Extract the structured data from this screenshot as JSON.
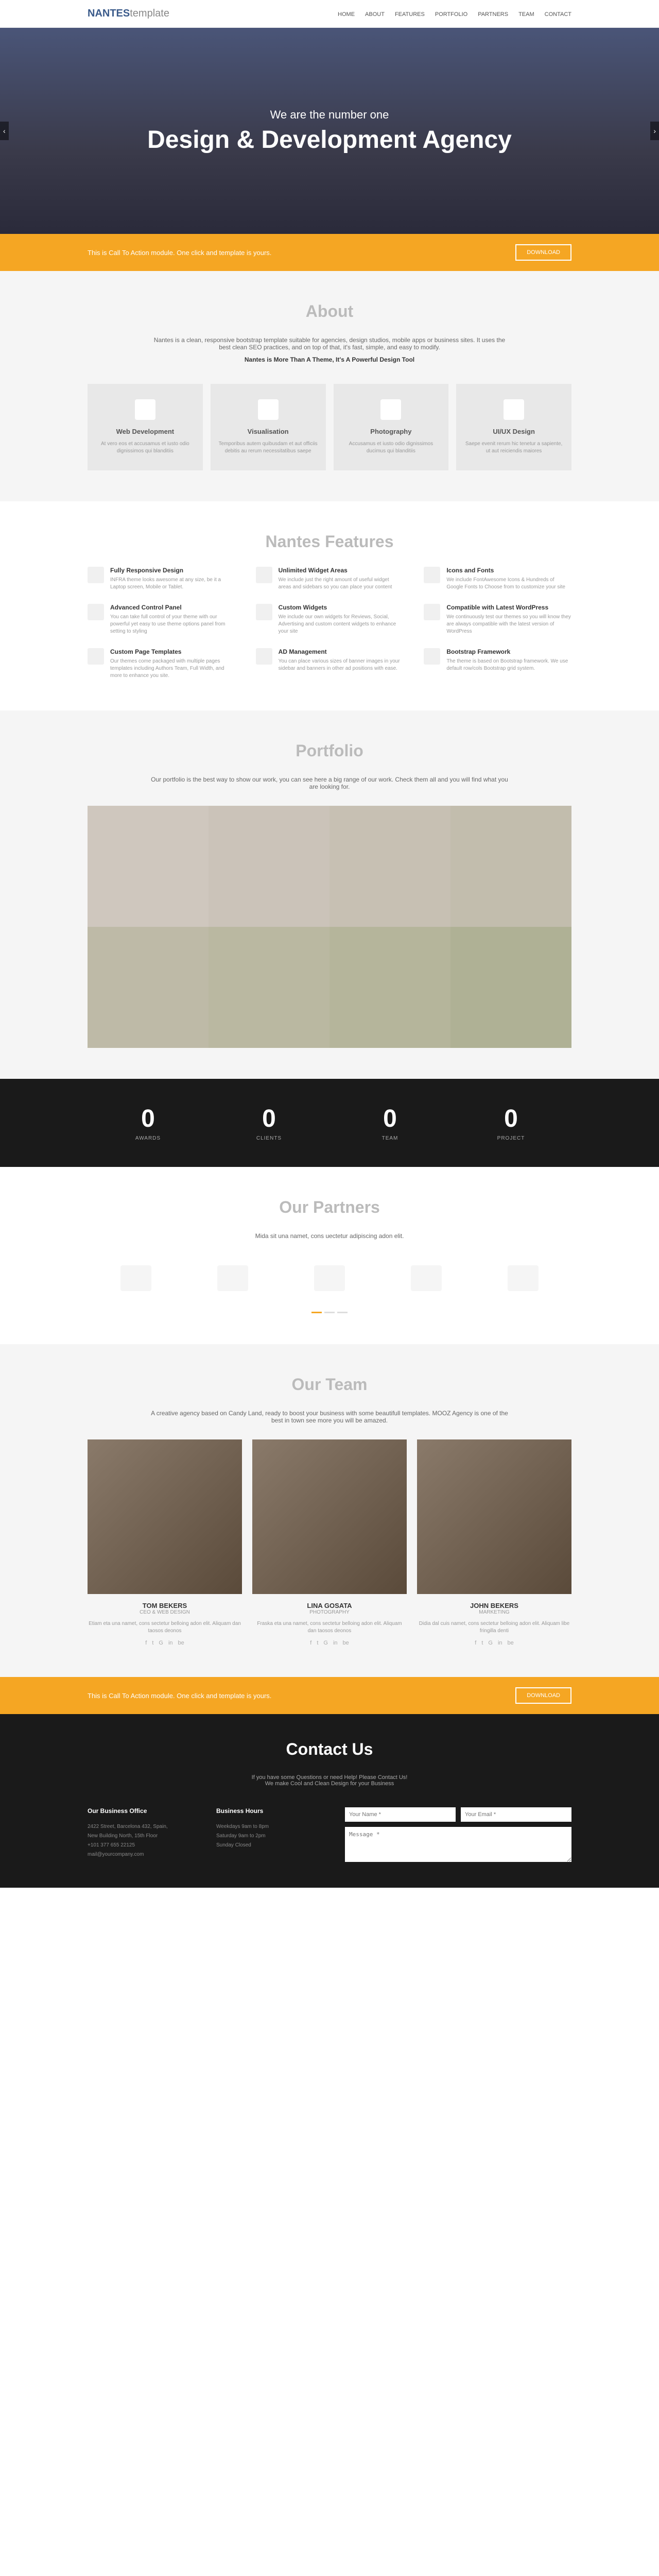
{
  "logo": {
    "bold": "NANTES",
    "light": "template"
  },
  "nav": [
    "HOME",
    "ABOUT",
    "FEATURES",
    "PORTFOLIO",
    "PARTNERS",
    "TEAM",
    "CONTACT"
  ],
  "hero": {
    "sub": "We are the number one",
    "title": "Design & Development Agency"
  },
  "cta": {
    "text": "This is Call To Action module. One click and template is yours.",
    "btn": "DOWNLOAD"
  },
  "about": {
    "title": "About",
    "desc": "Nantes is a clean, responsive bootstrap template suitable for agencies, design studios, mobile apps or business sites. It uses the best clean SEO practices, and on top of that, it's fast, simple, and easy to modify.",
    "tagline": "Nantes is More Than A Theme, It's A Powerful Design Tool",
    "cards": [
      {
        "title": "Web Development",
        "desc": "At vero eos et accusamus et iusto odio dignissimos qui blanditiis"
      },
      {
        "title": "Visualisation",
        "desc": "Temporibus autem quibusdam et aut officiis debitis au rerum necessitatibus saepe"
      },
      {
        "title": "Photography",
        "desc": "Accusamus et iusto odio dignissimos ducimus qui blanditiis"
      },
      {
        "title": "UI/UX Design",
        "desc": "Saepe evenit rerum hic tenetur a sapiente, ut aut reiciendis maiores"
      }
    ]
  },
  "features": {
    "title": "Nantes Features",
    "items": [
      {
        "title": "Fully Responsive Design",
        "desc": "INFRA theme looks awesome at any size, be it a Laptop screen, Mobile or Tablet."
      },
      {
        "title": "Unlimited Widget Areas",
        "desc": "We include just the right amount of useful widget areas and sidebars so you can place your content"
      },
      {
        "title": "Icons and Fonts",
        "desc": "We include FontAwesome Icons & Hundreds of Google Fonts to Choose from to customize your site"
      },
      {
        "title": "Advanced Control Panel",
        "desc": "You can take full control of your theme with our powerful yet easy to use theme options panel from setting to styling"
      },
      {
        "title": "Custom Widgets",
        "desc": "We include our own widgets for Reviews, Social, Advertising and custom content widgets to enhance your site"
      },
      {
        "title": "Compatible with Latest WordPress",
        "desc": "We continuously test our themes so you will know they are always compatible with the latest version of WordPress"
      },
      {
        "title": "Custom Page Templates",
        "desc": "Our themes come packaged with multiple pages templates including Authors Team, Full Width, and more to enhance you site."
      },
      {
        "title": "AD Management",
        "desc": "You can place various sizes of banner images in your sidebar and banners in other ad positions with ease."
      },
      {
        "title": "Bootstrap Framework",
        "desc": "The theme is based on Bootstrap framework. We use default row/cols Bootstrap grid system."
      }
    ]
  },
  "portfolio": {
    "title": "Portfolio",
    "desc": "Our portfolio is the best way to show our work, you can see here a big range of our work. Check them all and you will find what you are looking for."
  },
  "stats": [
    {
      "num": "0",
      "label": "AWARDS"
    },
    {
      "num": "0",
      "label": "CLIENTS"
    },
    {
      "num": "0",
      "label": "TEAM"
    },
    {
      "num": "0",
      "label": "PROJECT"
    }
  ],
  "partners": {
    "title": "Our Partners",
    "desc": "Mida sit una namet, cons uectetur adipiscing adon elit."
  },
  "team": {
    "title": "Our Team",
    "desc": "A creative agency based on Candy Land, ready to boost your business with some beautifull templates. MOOZ Agency is one of the best in town see more you will be amazed.",
    "members": [
      {
        "name": "TOM BEKERS",
        "role": "CEO & WEB DESIGN",
        "bio": "Etiam eta una namet, cons sectetur belloing adon elit. Aliquam dan taosos deonos"
      },
      {
        "name": "LINA GOSATA",
        "role": "PHOTOGRAPHY",
        "bio": "Fraska eta una namet, cons sectetur belloing adon elit. Aliquam dan taosos deonos"
      },
      {
        "name": "JOHN BEKERS",
        "role": "MARKETING",
        "bio": "Didia dal cuis namet, cons sectetur belloing adon elit. Aliquam libe fringilla denti"
      }
    ]
  },
  "contact": {
    "title": "Contact Us",
    "desc1": "If you have some Questions or need Help! Please Contact Us!",
    "desc2": "We make Cool and Clean Design for your Business",
    "office": {
      "title": "Our Business Office",
      "lines": [
        "2422 Street, Barcelona 432, Spain,",
        "New Building North, 15th Floor",
        "+101 377 655 22125",
        "mail@yourcompany.com"
      ]
    },
    "hours": {
      "title": "Business Hours",
      "lines": [
        "Weekdays 9am to 8pm",
        "Saturday 9am to 2pm",
        "Sunday Closed"
      ]
    },
    "form": {
      "name": "Your Name *",
      "email": "Your Email *",
      "msg": "Message *"
    }
  }
}
